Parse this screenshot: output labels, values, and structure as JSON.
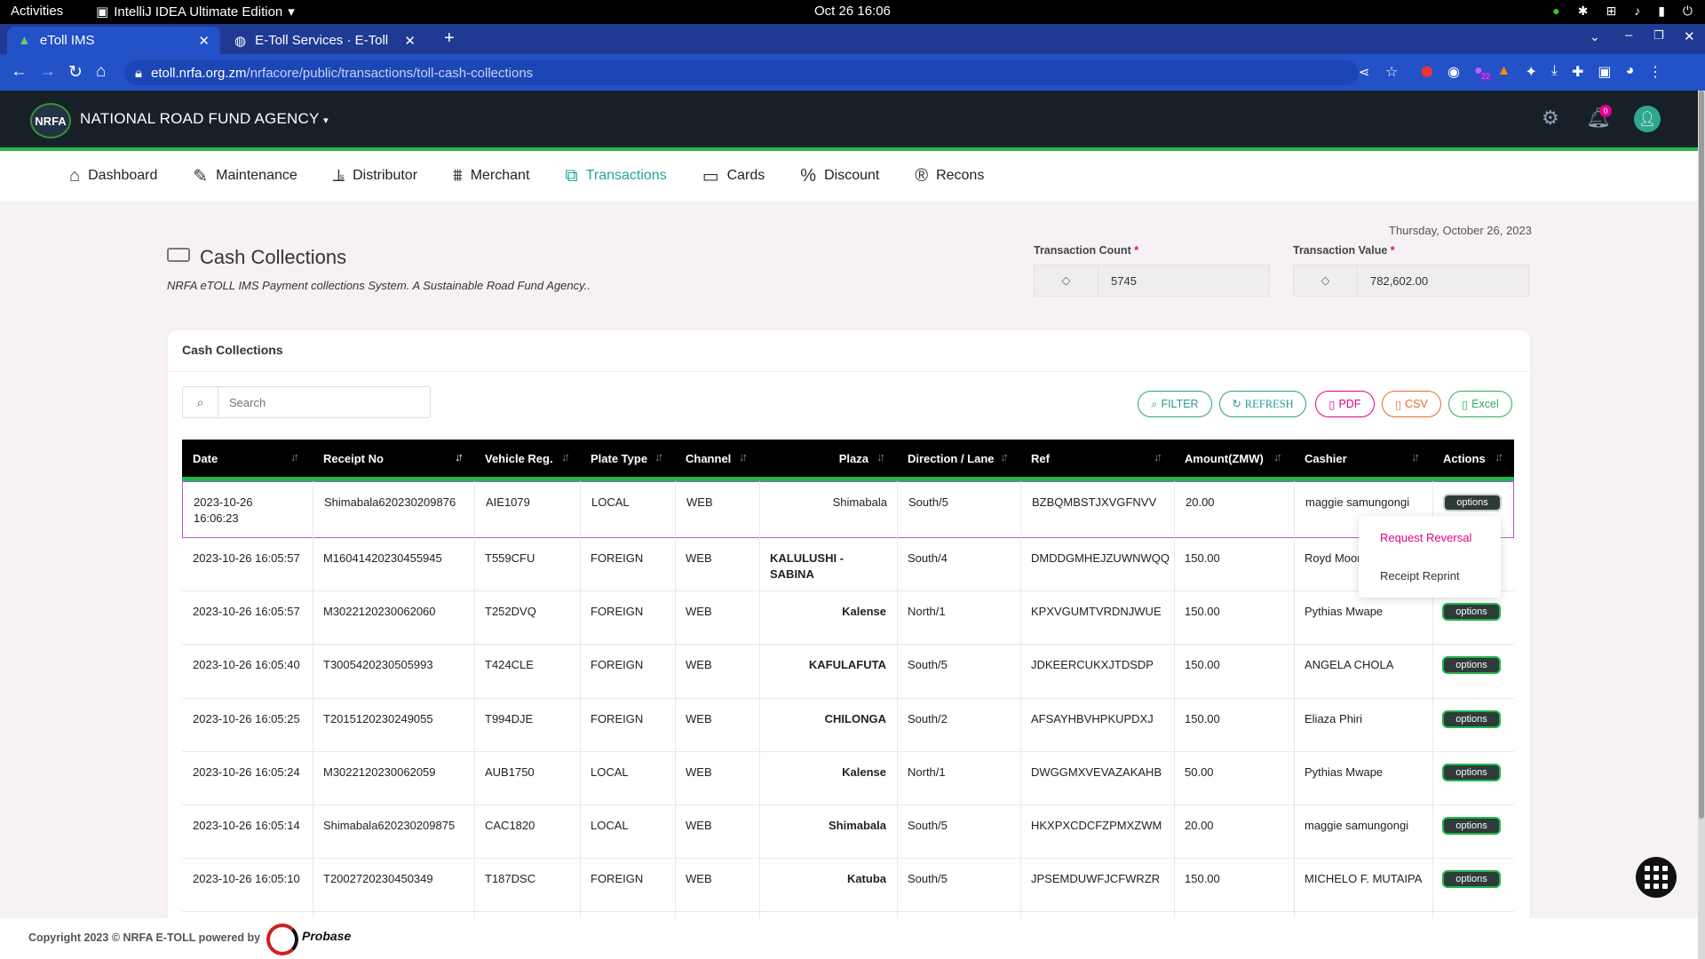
{
  "os": {
    "activities": "Activities",
    "app": "IntelliJ IDEA Ultimate Edition",
    "clock": "Oct 26  16:06"
  },
  "browser": {
    "tabs": [
      {
        "label": "eToll IMS"
      },
      {
        "label": "E-Toll Services · E-Toll"
      }
    ],
    "url_host": "etoll.nrfa.org.zm",
    "url_path": "/nrfacore/public/transactions/toll-cash-collections",
    "ext_badge": "22"
  },
  "header": {
    "org": "NATIONAL ROAD FUND AGENCY",
    "logo": "NRFA",
    "notif_count": "0"
  },
  "nav": {
    "items": [
      {
        "label": "Dashboard",
        "icon": "home-icon"
      },
      {
        "label": "Maintenance",
        "icon": "wrench-icon"
      },
      {
        "label": "Distributor",
        "icon": "chart-icon"
      },
      {
        "label": "Merchant",
        "icon": "factory-icon"
      },
      {
        "label": "Transactions",
        "icon": "handshake-icon",
        "active": true
      },
      {
        "label": "Cards",
        "icon": "card-icon"
      },
      {
        "label": "Discount",
        "icon": "percent-icon"
      },
      {
        "label": "Recons",
        "icon": "registered-icon"
      }
    ]
  },
  "page": {
    "date": "Thursday, October 26, 2023",
    "title": "Cash Collections",
    "subtitle": "NRFA eTOLL IMS Payment collections System. A Sustainable Road Fund Agency..",
    "count_label": "Transaction Count",
    "count_value": "5745",
    "value_label": "Transaction Value",
    "value_value": "782,602.00",
    "required_mark": "*"
  },
  "card": {
    "title": "Cash Collections",
    "search_placeholder": "Search",
    "buttons": {
      "filter": "FILTER",
      "refresh": "REFRESH",
      "pdf": "PDF",
      "csv": "CSV",
      "excel": "Excel"
    }
  },
  "table": {
    "columns": [
      "Date",
      "Receipt No",
      "Vehicle Reg.",
      "Plate Type",
      "Channel",
      "Plaza",
      "Direction / Lane",
      "Ref",
      "Amount(ZMW)",
      "Cashier",
      "Actions"
    ],
    "options_label": "options",
    "rows": [
      {
        "date": "2023-10-26",
        "date2": "16:06:23",
        "receipt": "Shimabala620230209876",
        "vehicle": "AIE1079",
        "plate": "LOCAL",
        "channel": "WEB",
        "plaza": "Shimabala",
        "direction": "South/5",
        "ref": "BZBQMBSTJXVGFNVV",
        "amount": "20.00",
        "cashier": "maggie samungongi"
      },
      {
        "date": "2023-10-26 16:05:57",
        "receipt": "M16041420230455945",
        "vehicle": "T559CFU",
        "plate": "FOREIGN",
        "channel": "WEB",
        "plaza": "KALULUSHI - SABINA",
        "direction": "South/4",
        "ref": "DMDDGMHEJZUWNWQQ",
        "amount": "150.00",
        "cashier": "Royd Moon"
      },
      {
        "date": "2023-10-26 16:05:57",
        "receipt": "M3022120230062060",
        "vehicle": "T252DVQ",
        "plate": "FOREIGN",
        "channel": "WEB",
        "plaza": "Kalense",
        "direction": "North/1",
        "ref": "KPXVGUMTVRDNJWUE",
        "amount": "150.00",
        "cashier": "Pythias Mwape"
      },
      {
        "date": "2023-10-26 16:05:40",
        "receipt": "T3005420230505993",
        "vehicle": "T424CLE",
        "plate": "FOREIGN",
        "channel": "WEB",
        "plaza": "KAFULAFUTA",
        "direction": "South/5",
        "ref": "JDKEERCUKXJTDSDP",
        "amount": "150.00",
        "cashier": "ANGELA CHOLA"
      },
      {
        "date": "2023-10-26 16:05:25",
        "receipt": "T2015120230249055",
        "vehicle": "T994DJE",
        "plate": "FOREIGN",
        "channel": "WEB",
        "plaza": "CHILONGA",
        "direction": "South/2",
        "ref": "AFSAYHBVHPKUPDXJ",
        "amount": "150.00",
        "cashier": "Eliaza Phiri"
      },
      {
        "date": "2023-10-26 16:05:24",
        "receipt": "M3022120230062059",
        "vehicle": "AUB1750",
        "plate": "LOCAL",
        "channel": "WEB",
        "plaza": "Kalense",
        "direction": "North/1",
        "ref": "DWGGMXVEVAZAKAHB",
        "amount": "50.00",
        "cashier": "Pythias Mwape"
      },
      {
        "date": "2023-10-26 16:05:14",
        "receipt": "Shimabala620230209875",
        "vehicle": "CAC1820",
        "plate": "LOCAL",
        "channel": "WEB",
        "plaza": "Shimabala",
        "direction": "South/5",
        "ref": "HKXPXCDCFZPMXZWM",
        "amount": "20.00",
        "cashier": "maggie samungongi"
      },
      {
        "date": "2023-10-26 16:05:10",
        "receipt": "T2002720230450349",
        "vehicle": "T187DSC",
        "plate": "FOREIGN",
        "channel": "WEB",
        "plaza": "Katuba",
        "direction": "South/5",
        "ref": "JPSEMDUWFJCFWRZR",
        "amount": "150.00",
        "cashier": "MICHELO F. MUTAIPA"
      }
    ]
  },
  "dropdown": {
    "items": [
      "Request Reversal",
      "Receipt Reprint"
    ]
  },
  "footer": {
    "copyright": "Copyright 2023 © NRFA E-TOLL powered by",
    "brand": "Probase"
  },
  "colors": {
    "accent": "#22a59a",
    "green": "#1fb847",
    "pink": "#e3008c",
    "dark": "#172027"
  }
}
